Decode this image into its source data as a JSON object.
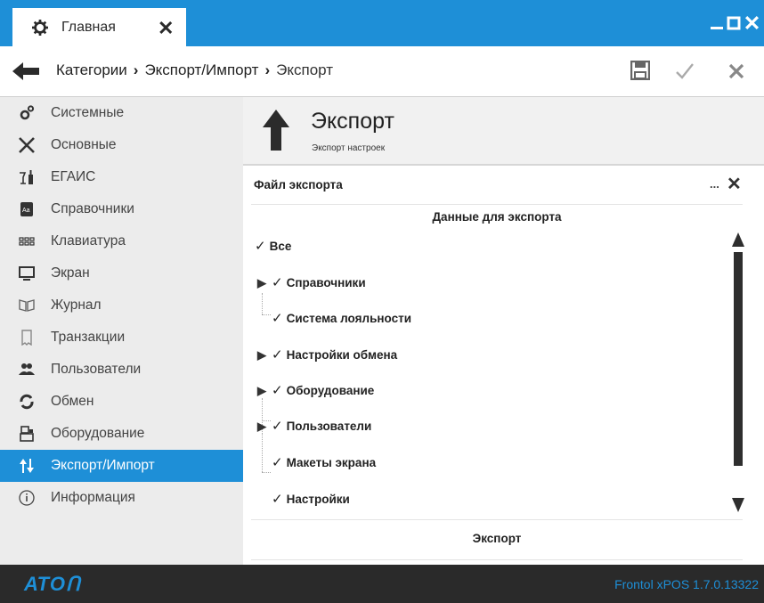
{
  "window": {
    "tab_title": "Главная",
    "tab_close_icon": "close-icon",
    "controls": [
      "minimize-icon",
      "maximize-icon",
      "close-icon"
    ]
  },
  "navbar": {
    "back_icon": "back-arrow-icon",
    "breadcrumb": [
      "Категории",
      "Экспорт/Импорт",
      "Экспорт"
    ],
    "separator": "›",
    "actions": [
      "save-icon",
      "check-icon",
      "close-icon"
    ]
  },
  "sidebar": {
    "items": [
      {
        "label": "Системные",
        "icon": "gears-icon"
      },
      {
        "label": "Основные",
        "icon": "tools-icon"
      },
      {
        "label": "ЕГАИС",
        "icon": "bottle-glass-icon"
      },
      {
        "label": "Справочники",
        "icon": "book-icon"
      },
      {
        "label": "Клавиатура",
        "icon": "keyboard-icon"
      },
      {
        "label": "Экран",
        "icon": "monitor-icon"
      },
      {
        "label": "Журнал",
        "icon": "journal-icon"
      },
      {
        "label": "Транзакции",
        "icon": "receipt-icon"
      },
      {
        "label": "Пользователи",
        "icon": "users-icon"
      },
      {
        "label": "Обмен",
        "icon": "sync-icon"
      },
      {
        "label": "Оборудование",
        "icon": "cash-register-icon"
      },
      {
        "label": "Экспорт/Импорт",
        "icon": "export-import-icon",
        "active": true
      },
      {
        "label": "Информация",
        "icon": "info-icon"
      }
    ]
  },
  "main": {
    "header": {
      "title": "Экспорт",
      "subtitle": "Экспорт настроек",
      "icon": "up-arrow-icon"
    },
    "file_row": {
      "label": "Файл экспорта",
      "browse": "...",
      "clear_icon": "close-icon"
    },
    "data_header": "Данные для экспорта",
    "tree": [
      {
        "label": "Все",
        "checked": true,
        "expandable": false
      },
      {
        "label": "Справочники",
        "checked": true,
        "expandable": true
      },
      {
        "label": "Система лояльности",
        "checked": true,
        "expandable": false
      },
      {
        "label": "Настройки обмена",
        "checked": true,
        "expandable": true
      },
      {
        "label": "Оборудование",
        "checked": true,
        "expandable": true
      },
      {
        "label": "Пользователи",
        "checked": true,
        "expandable": true
      },
      {
        "label": "Макеты экрана",
        "checked": true,
        "expandable": false
      },
      {
        "label": "Настройки",
        "checked": true,
        "expandable": false
      }
    ],
    "check_glyph": "✓",
    "expand_glyph": "▶",
    "export_button": "Экспорт"
  },
  "footer": {
    "logo": "ATOL",
    "version": "Frontol xPOS 1.7.0.13322"
  },
  "colors": {
    "accent": "#1e8fd7",
    "footer_bg": "#2a2a2a",
    "sidebar_bg": "#ececec"
  }
}
